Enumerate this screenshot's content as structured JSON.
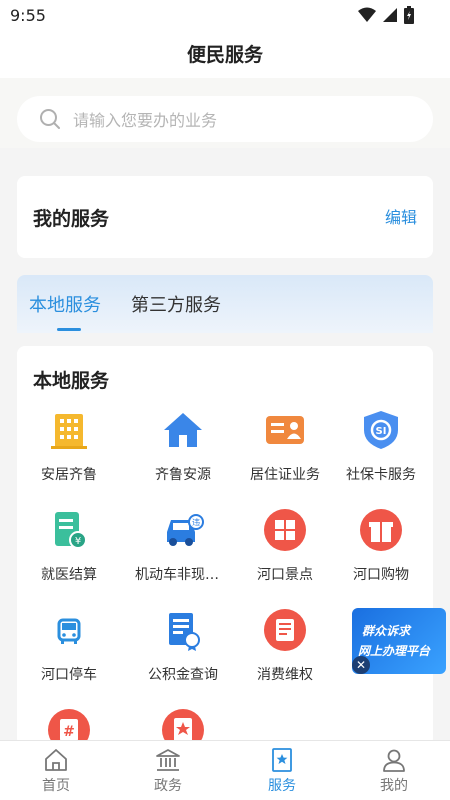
{
  "status": {
    "time": "9:55"
  },
  "header": {
    "title": "便民服务"
  },
  "search": {
    "placeholder": "请输入您要办的业务"
  },
  "my_service": {
    "title": "我的服务",
    "edit_label": "编辑"
  },
  "tabs": [
    {
      "label": "本地服务"
    },
    {
      "label": "第三方服务"
    }
  ],
  "local": {
    "title": "本地服务",
    "items": [
      {
        "label": "安居齐鲁",
        "icon": "building-icon"
      },
      {
        "label": "齐鲁安源",
        "icon": "house-icon"
      },
      {
        "label": "居住证业务",
        "icon": "id-card-icon"
      },
      {
        "label": "社保卡服务",
        "icon": "social-security-shield-icon"
      },
      {
        "label": "就医结算",
        "icon": "medical-bill-icon"
      },
      {
        "label": "机动车非现场...",
        "icon": "car-violation-icon"
      },
      {
        "label": "河口景点",
        "icon": "scenic-spot-icon"
      },
      {
        "label": "河口购物",
        "icon": "gift-shopping-icon"
      },
      {
        "label": "河口停车",
        "icon": "bus-parking-icon"
      },
      {
        "label": "公积金查询",
        "icon": "provident-fund-icon"
      },
      {
        "label": "消费维权",
        "icon": "consumer-rights-icon"
      },
      {
        "label": "",
        "icon": "hash-icon"
      },
      {
        "label": "",
        "icon": "star-badge-icon"
      }
    ]
  },
  "float_banner": {
    "line1": "群众诉求",
    "line2": "网上办理平台"
  },
  "bottom_nav": [
    {
      "label": "首页",
      "icon": "home-icon"
    },
    {
      "label": "政务",
      "icon": "government-building-icon"
    },
    {
      "label": "服务",
      "icon": "service-bookmark-icon",
      "active": true
    },
    {
      "label": "我的",
      "icon": "user-icon"
    }
  ],
  "colors": {
    "accent": "#2b8fde",
    "orange": "#f0883e",
    "red": "#ef5648",
    "teal": "#3bbf9c"
  }
}
